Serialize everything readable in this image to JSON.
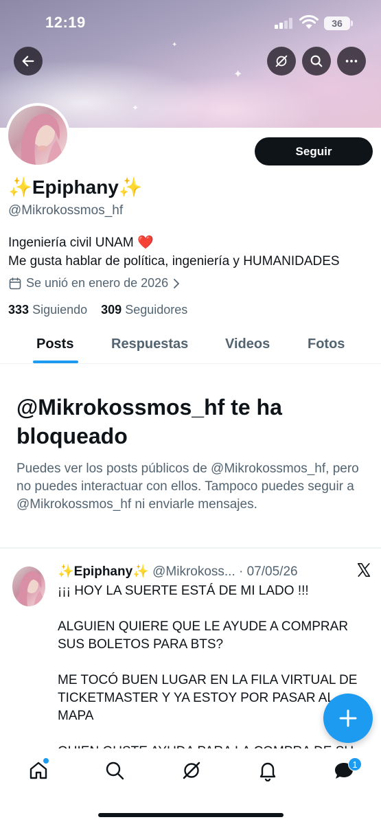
{
  "status_bar": {
    "time": "12:19",
    "battery": "36"
  },
  "colors": {
    "accent": "#1d9bf0",
    "text": "#0f1419",
    "muted": "#536471"
  },
  "profile": {
    "follow_label": "Seguir",
    "display_name": "✨Epiphany✨",
    "handle": "@Mikrokossmos_hf",
    "bio_line1": "Ingeniería civil UNAM ❤️",
    "bio_line2": "Me gusta hablar de política, ingeniería y HUMANIDADES",
    "joined": "Se unió en enero de 2026",
    "following_count": "333",
    "following_label": "Siguiendo",
    "followers_count": "309",
    "followers_label": "Seguidores"
  },
  "tabs": [
    {
      "label": "Posts",
      "active": true
    },
    {
      "label": "Respuestas"
    },
    {
      "label": "Videos"
    },
    {
      "label": "Fotos"
    }
  ],
  "blocked": {
    "title": "@Mikrokossmos_hf te ha bloqueado",
    "description": "Puedes ver los posts públicos de @Mikrokossmos_hf, pero no puedes interactuar con ellos. Tampoco puedes seguir a @Mikrokossmos_hf ni enviarle mensajes."
  },
  "post": {
    "name": "✨Epiphany✨",
    "handle": "@Mikrokoss...",
    "date": "· 07/05/26",
    "body": "¡¡¡ HOY LA SUERTE ESTÁ DE MI LADO !!!\n\nALGUIEN QUIERE QUE LE AYUDE A COMPRAR SUS BOLETOS PARA BTS?\n\nME TOCÓ BUEN LUGAR EN LA FILA VIRTUAL DE TICKETMASTER Y YA ESTOY POR PASAR AL MAPA\n\nQUIEN GUSTE AYUDA PARA LA COMPRA DE SU"
  },
  "bottom_nav": {
    "items": [
      "home-icon",
      "search-icon",
      "grok-icon",
      "notifications-icon",
      "messages-icon"
    ],
    "messages_badge": "1"
  }
}
